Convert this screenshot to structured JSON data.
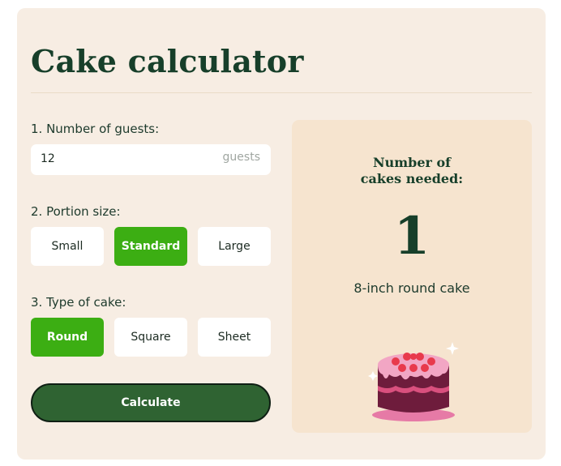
{
  "title": "Cake calculator",
  "guests": {
    "label": "1. Number of guests:",
    "value": "12",
    "unit": "guests"
  },
  "portion": {
    "label": "2. Portion size:",
    "options": [
      "Small",
      "Standard",
      "Large"
    ],
    "selected": "Standard"
  },
  "cake_type": {
    "label": "3. Type of cake:",
    "options": [
      "Round",
      "Square",
      "Sheet"
    ],
    "selected": "Round"
  },
  "calculate_label": "Calculate",
  "result": {
    "heading_line1": "Number of",
    "heading_line2": "cakes needed:",
    "count": "1",
    "description": "8-inch round cake",
    "illustration": "layered-cake-icon"
  },
  "colors": {
    "accent_green": "#3cae13",
    "button_green": "#2f6332",
    "title_green": "#173f2a",
    "card_bg": "#f7ede3",
    "result_bg": "#f6e4cf"
  }
}
